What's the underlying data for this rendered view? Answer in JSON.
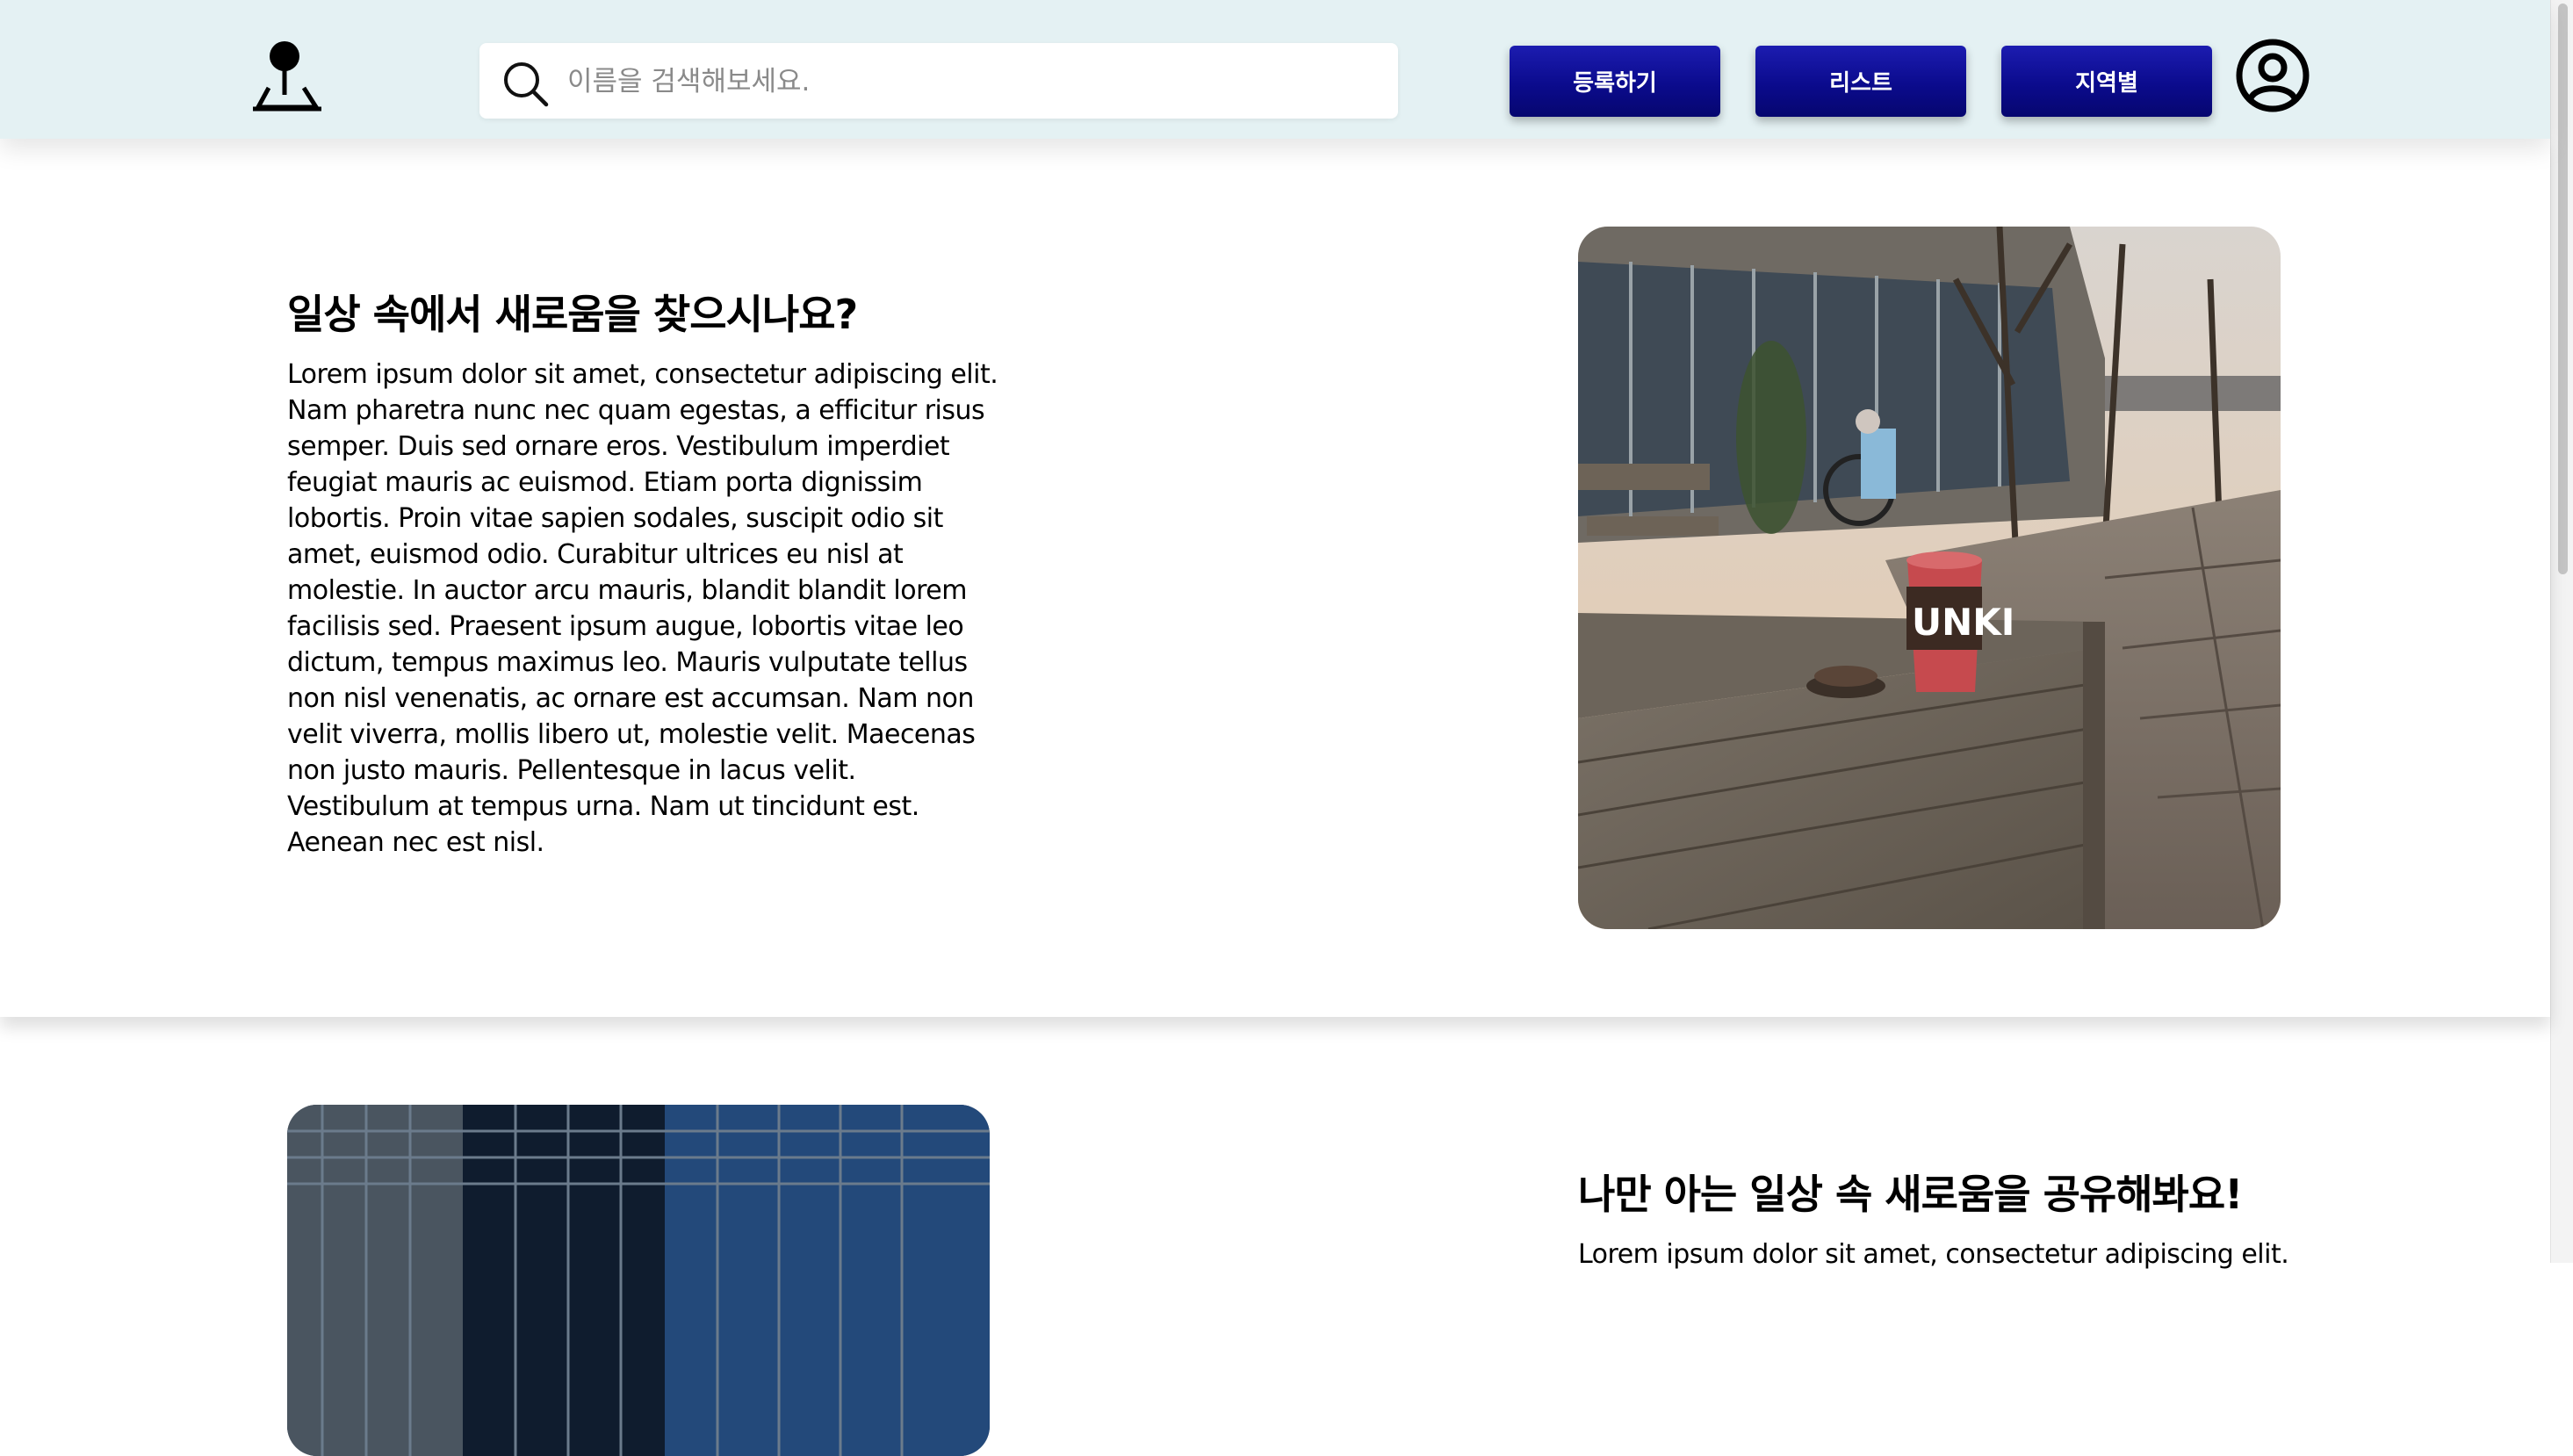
{
  "header": {
    "logo_icon": "map-pin-icon",
    "search": {
      "placeholder": "이름을 검색해보세요.",
      "value": "",
      "icon": "search-icon"
    },
    "nav": {
      "register_label": "등록하기",
      "list_label": "리스트",
      "region_label": "지역별"
    },
    "profile_icon": "user-circle-icon",
    "accent_color": "#0b0b8d",
    "background_color": "#e4f1f3"
  },
  "sections": [
    {
      "title": "일상 속에서 새로움을 찾으시나요?",
      "body": "Lorem ipsum dolor sit amet, consectetur adipiscing elit. Nam pharetra nunc nec quam egestas, a efficitur risus semper. Duis sed ornare eros. Vestibulum imperdiet feugiat mauris ac euismod. Etiam porta dignissim lobortis. Proin vitae sapien sodales, suscipit odio sit amet, euismod odio. Curabitur ultrices eu nisl at molestie. In auctor arcu mauris, blandit blandit lorem facilisis sed. Praesent ipsum augue, lobortis vitae leo dictum, tempus maximus leo. Mauris vulputate tellus non nisl venenatis, ac ornare est accumsan. Nam non velit viverra, mollis libero ut, molestie velit. Maecenas non justo mauris. Pellentesque in lacus velit. Vestibulum at tempus urna. Nam ut tincidunt est. Aenean nec est nisl.",
      "image_cup_text": "UNKI"
    },
    {
      "title": "나만 아는 일상 속 새로움을 공유해봐요!",
      "body": "Lorem ipsum dolor sit amet, consectetur adipiscing elit."
    }
  ]
}
